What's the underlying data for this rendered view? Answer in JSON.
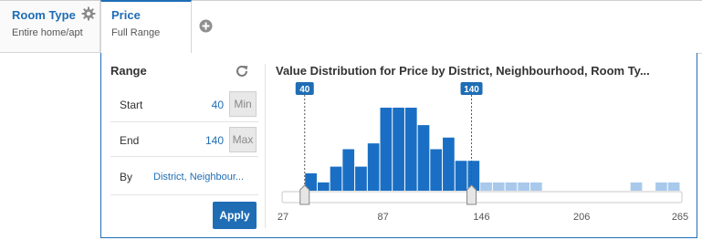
{
  "tabs": [
    {
      "title": "Room Type",
      "subtitle": "Entire home/apt"
    },
    {
      "title": "Price",
      "subtitle": "Full Range"
    }
  ],
  "range": {
    "title": "Range",
    "start_label": "Start",
    "start_value": "40",
    "start_button": "Min",
    "end_label": "End",
    "end_value": "140",
    "end_button": "Max",
    "by_label": "By",
    "by_value": "District, Neighbour...",
    "apply_label": "Apply"
  },
  "colors": {
    "accent": "#1f6db5",
    "bar_selected": "#1a6fc4",
    "bar_unselected": "#a9c9ec"
  },
  "chart_data": {
    "type": "bar",
    "title": "Value Distribution for Price by District, Neighbourhood, Room Ty...",
    "xlim": [
      27,
      265
    ],
    "x_ticks": [
      "27",
      "87",
      "146",
      "206",
      "265"
    ],
    "selection": {
      "start": 40,
      "end": 140,
      "start_label": "40",
      "end_label": "140"
    },
    "bin_width": 7.5,
    "bins": [
      {
        "x": 40,
        "v": 0.21
      },
      {
        "x": 47.5,
        "v": 0.1
      },
      {
        "x": 55,
        "v": 0.29
      },
      {
        "x": 62.5,
        "v": 0.5
      },
      {
        "x": 70,
        "v": 0.29
      },
      {
        "x": 77.5,
        "v": 0.57
      },
      {
        "x": 85,
        "v": 1.0
      },
      {
        "x": 92.5,
        "v": 1.0
      },
      {
        "x": 100,
        "v": 1.0
      },
      {
        "x": 107.5,
        "v": 0.79
      },
      {
        "x": 115,
        "v": 0.5
      },
      {
        "x": 122.5,
        "v": 0.64
      },
      {
        "x": 130,
        "v": 0.36
      },
      {
        "x": 137.5,
        "v": 0.36
      },
      {
        "x": 145,
        "v": 0.1
      },
      {
        "x": 152.5,
        "v": 0.1
      },
      {
        "x": 160,
        "v": 0.1
      },
      {
        "x": 167.5,
        "v": 0.1
      },
      {
        "x": 175,
        "v": 0.1
      },
      {
        "x": 235,
        "v": 0.1
      },
      {
        "x": 250,
        "v": 0.1
      },
      {
        "x": 257.5,
        "v": 0.1
      }
    ]
  }
}
